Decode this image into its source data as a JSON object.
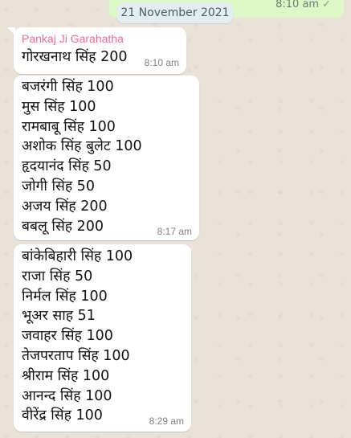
{
  "chat": {
    "date_chip": "21 November 2021",
    "outgoing": {
      "time": "8:10 am",
      "tick": "✓"
    },
    "messages": [
      {
        "sender": "Pankaj Ji Garahatha",
        "lines": [
          "गोरखनाथ सिंह 200"
        ],
        "time": "8:10 am"
      },
      {
        "lines": [
          "बजरंगी सिंह 100",
          "मुस सिंह 100",
          "रामबाबू सिंह 100",
          "अशोक सिंह बुलेट 100",
          "हृदयानंद सिंह 50",
          "जोगी सिंह 50",
          "अजय सिंह 200",
          "बबलू सिंह 200"
        ],
        "time": "8:17 am"
      },
      {
        "lines": [
          "बांकेबिहारी सिंह 100",
          "राजा सिंह 50",
          "निर्मल सिंह 100",
          "भूअर साह 51",
          "जवाहर सिंह 100",
          "तेजपरताप सिंह 100",
          "श्रीराम सिंह 100",
          "आनन्द सिंह 100",
          "वीरेंद्र सिंह 100"
        ],
        "time": "8:29 am"
      }
    ]
  }
}
